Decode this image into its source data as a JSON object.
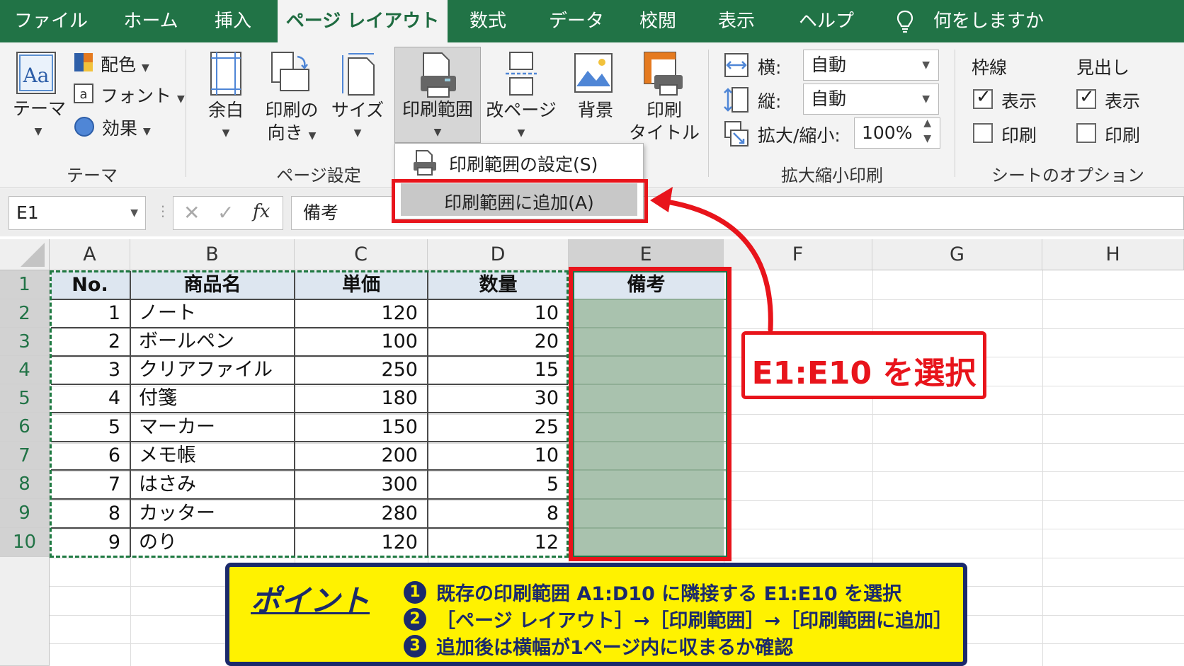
{
  "tabs": [
    {
      "label": "ファイル",
      "active": false
    },
    {
      "label": "ホーム",
      "active": false
    },
    {
      "label": "挿入",
      "active": false
    },
    {
      "label": "ページ レイアウト",
      "active": true
    },
    {
      "label": "数式",
      "active": false
    },
    {
      "label": "データ",
      "active": false
    },
    {
      "label": "校閲",
      "active": false
    },
    {
      "label": "表示",
      "active": false
    },
    {
      "label": "ヘルプ",
      "active": false
    }
  ],
  "tell_me": "何をしますか",
  "ribbon": {
    "theme_group": {
      "themes_label": "テーマ",
      "colors_label": "配色",
      "fonts_label": "フォント",
      "effects_label": "効果",
      "group_label": "テーマ"
    },
    "page_setup_group": {
      "margins_label": "余白",
      "orientation_label_1": "印刷の",
      "orientation_label_2": "向き",
      "size_label": "サイズ",
      "print_area_label": "印刷範囲",
      "breaks_label": "改ページ",
      "background_label": "背景",
      "print_titles_label_1": "印刷",
      "print_titles_label_2": "タイトル",
      "group_label": "ページ設定"
    },
    "scale_group": {
      "width_label": "横:",
      "width_value": "自動",
      "height_label": "縦:",
      "height_value": "自動",
      "scale_label": "拡大/縮小:",
      "scale_value": "100%",
      "group_label": "拡大縮小印刷"
    },
    "sheet_options_group": {
      "gridlines_label": "枠線",
      "headings_label": "見出し",
      "view_label": "表示",
      "print_label": "印刷",
      "gridlines_view_checked": true,
      "gridlines_print_checked": false,
      "headings_view_checked": true,
      "headings_print_checked": false,
      "group_label": "シートのオプション"
    }
  },
  "dropdown": {
    "set_print_area": "印刷範囲の設定(S)",
    "add_to_print_area": "印刷範囲に追加(A)"
  },
  "formula_bar": {
    "name_box": "E1",
    "fx": "fx",
    "content": "備考"
  },
  "sheet": {
    "columns": [
      "A",
      "B",
      "C",
      "D",
      "E",
      "F",
      "G",
      "H"
    ],
    "rows": [
      "1",
      "2",
      "3",
      "4",
      "5",
      "6",
      "7",
      "8",
      "9",
      "10"
    ],
    "headers": [
      "No.",
      "商品名",
      "単価",
      "数量",
      "備考"
    ],
    "data": [
      [
        "1",
        "ノート",
        "120",
        "10"
      ],
      [
        "2",
        "ボールペン",
        "100",
        "20"
      ],
      [
        "3",
        "クリアファイル",
        "250",
        "15"
      ],
      [
        "4",
        "付箋",
        "180",
        "30"
      ],
      [
        "5",
        "マーカー",
        "150",
        "25"
      ],
      [
        "6",
        "メモ帳",
        "200",
        "10"
      ],
      [
        "7",
        "はさみ",
        "300",
        "5"
      ],
      [
        "8",
        "カッター",
        "280",
        "8"
      ],
      [
        "9",
        "のり",
        "120",
        "12"
      ]
    ]
  },
  "callout": "E1:E10 を選択",
  "point": {
    "title": "ポイント",
    "items": [
      {
        "num": "1",
        "text": "既存の印刷範囲 A1:D10 に隣接する E1:E10 を選択"
      },
      {
        "num": "2",
        "text": "［ページ レイアウト］→［印刷範囲］→［印刷範囲に追加］"
      },
      {
        "num": "3",
        "text": "追加後は横幅が1ページ内に収まるか確認"
      }
    ]
  },
  "colors": {
    "excel_green": "#217346",
    "highlight_red": "#e8141b",
    "point_yellow": "#fff200",
    "point_navy": "#1b2a6b",
    "selection_fill": "#a9c2ae"
  }
}
